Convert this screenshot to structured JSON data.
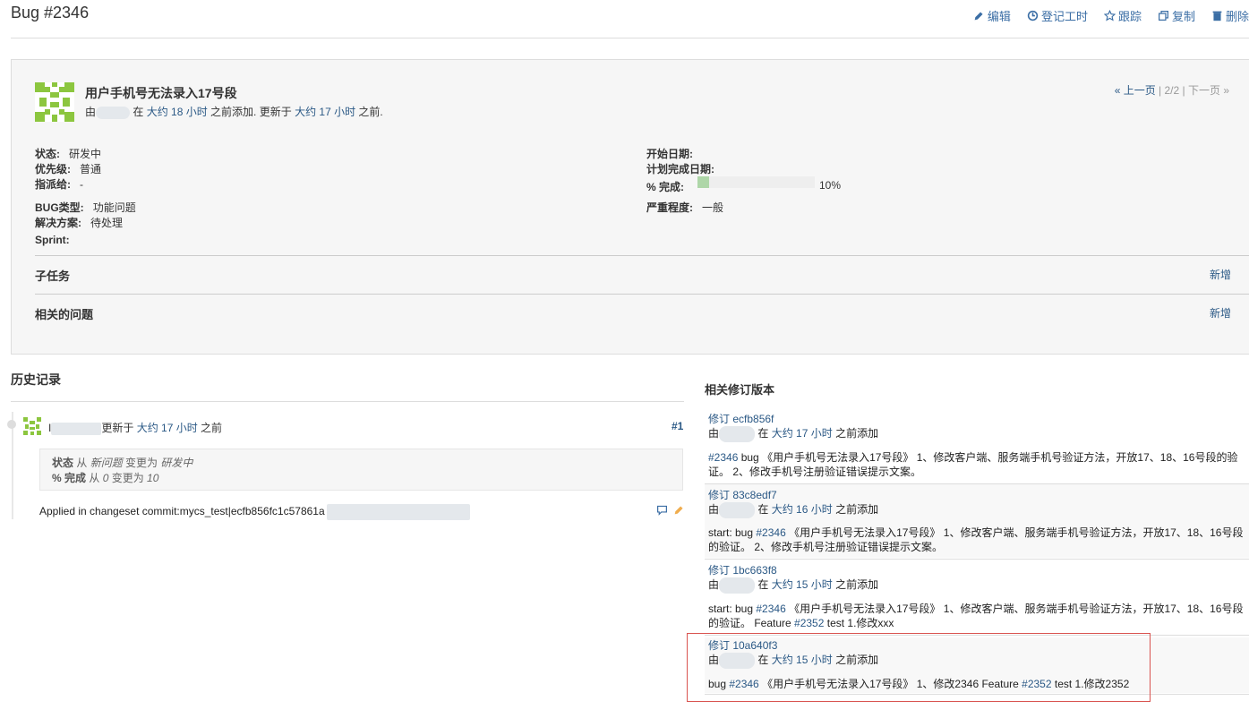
{
  "header": {
    "title": "Bug #2346",
    "actions": [
      {
        "label": "编辑",
        "icon": "pencil-icon"
      },
      {
        "label": "登记工时",
        "icon": "clock-icon"
      },
      {
        "label": "跟踪",
        "icon": "star-icon"
      },
      {
        "label": "复制",
        "icon": "copy-icon"
      },
      {
        "label": "删除",
        "icon": "trash-icon"
      }
    ]
  },
  "issue": {
    "subject": "用户手机号无法录入17号段",
    "by": "由",
    "at_text": " 在 ",
    "added_ago": "大约 18 小时",
    "added_suffix": " 之前添加. 更新于 ",
    "updated_ago": "大约 17 小时",
    "updated_suffix": " 之前.",
    "pager": {
      "prev": "« 上一页",
      "pos": " | 2/2 | ",
      "next": "下一页 »"
    },
    "attributes": {
      "status": {
        "label": "状态:",
        "value": "研发中"
      },
      "priority": {
        "label": "优先级:",
        "value": "普通"
      },
      "assignee": {
        "label": "指派给:",
        "value": "-"
      },
      "bug_type": {
        "label": "BUG类型:",
        "value": "功能问题"
      },
      "resolution": {
        "label": "解决方案:",
        "value": "待处理"
      },
      "sprint": {
        "label": "Sprint:",
        "value": ""
      },
      "start_date": {
        "label": "开始日期:",
        "value": ""
      },
      "due_date": {
        "label": "计划完成日期:",
        "value": ""
      },
      "done": {
        "label": "% 完成:",
        "value": "10%",
        "fraction": 0.1
      },
      "severity": {
        "label": "严重程度:",
        "value": "一般"
      }
    },
    "subtasks": {
      "title": "子任务",
      "add": "新增"
    },
    "relations": {
      "title": "相关的问题",
      "add": "新增"
    }
  },
  "history": {
    "title": "历史记录",
    "journal": {
      "author_prefix": "I",
      "updated": "更新于 ",
      "ago": "大约 17 小时",
      "suffix": " 之前",
      "number": "#1",
      "details": [
        {
          "field": "状态",
          "from_word": " 从 ",
          "old": "新问题",
          "to_word": " 变更为 ",
          "new": "研发中"
        },
        {
          "field": "% 完成",
          "from_word": " 从 ",
          "old": "0",
          "to_word": " 变更为 ",
          "new": "10"
        }
      ],
      "notes": "Applied in changeset commit:mycs_test|ecfb856fc1c57861a"
    }
  },
  "revisions": {
    "title": "相关修订版本",
    "items": [
      {
        "rev": "修订 ecfb856f",
        "by": "由",
        "at": "在 ",
        "ago": "大约 17 小时",
        "suffix": " 之前添加",
        "pre": "",
        "ref1": "#2346",
        "text1": " bug 《用户手机号无法录入17号段》 1、修改客户端、服务端手机号验证方法，开放17、18、16号段的验证。 2、修改手机号注册验证错误提示文案。",
        "ref2": "",
        "text2": ""
      },
      {
        "rev": "修订 83c8edf7",
        "by": "由",
        "at": "在 ",
        "ago": "大约 16 小时",
        "suffix": " 之前添加",
        "pre": "start: bug ",
        "ref1": "#2346",
        "text1": " 《用户手机号无法录入17号段》 1、修改客户端、服务端手机号验证方法，开放17、18、16号段的验证。 2、修改手机号注册验证错误提示文案。",
        "ref2": "",
        "text2": ""
      },
      {
        "rev": "修订 1bc663f8",
        "by": "由",
        "at": "在 ",
        "ago": "大约 15 小时",
        "suffix": " 之前添加",
        "pre": "start: bug ",
        "ref1": "#2346",
        "text1": " 《用户手机号无法录入17号段》 1、修改客户端、服务端手机号验证方法，开放17、18、16号段的验证。 Feature ",
        "ref2": "#2352",
        "text2": " test 1.修改xxx"
      },
      {
        "rev": "修订 10a640f3",
        "by": "由",
        "at": "在 ",
        "ago": "大约 15 小时",
        "suffix": " 之前添加",
        "pre": "bug ",
        "ref1": "#2346",
        "text1": " 《用户手机号无法录入17号段》 1、修改2346 Feature ",
        "ref2": "#2352",
        "text2": " test 1.修改2352"
      }
    ]
  }
}
